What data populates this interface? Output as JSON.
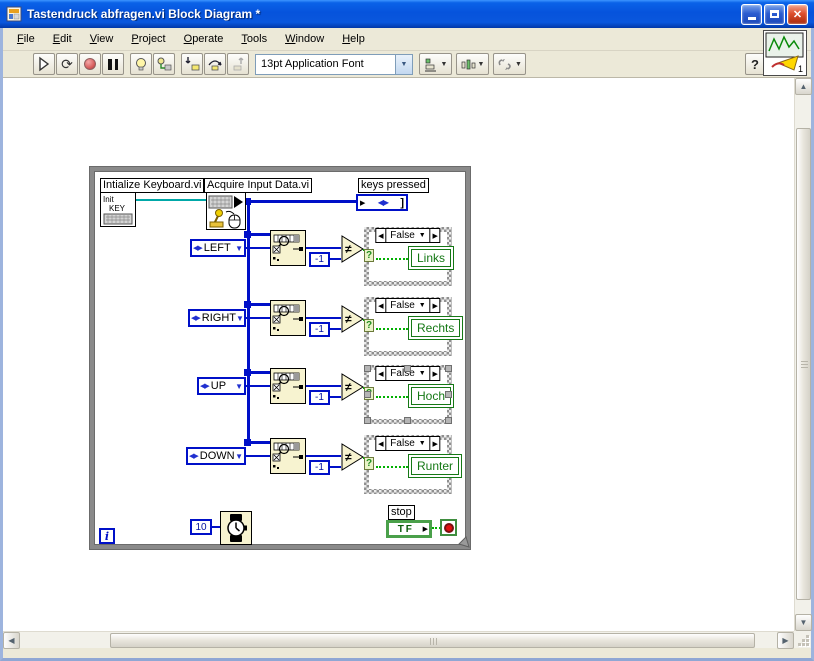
{
  "window": {
    "title": "Tastendruck abfragen.vi Block Diagram *",
    "menus": [
      "File",
      "Edit",
      "View",
      "Project",
      "Operate",
      "Tools",
      "Window",
      "Help"
    ],
    "toolbar": {
      "font_selector": "13pt Application Font",
      "help_label": "?",
      "pane_number": "1"
    }
  },
  "icons": {
    "incdec": "◀▶",
    "dropdown": "▼",
    "case_prev": "◀",
    "case_next": "▶",
    "scroll_up": "▲",
    "scroll_down": "▼",
    "scroll_left": "◀",
    "scroll_right": "▶",
    "array_frame": "▶",
    "array_glyph": "◀▶",
    "array_bracket": "]",
    "tf_arrow": "▶",
    "close": "✕"
  },
  "colors": {
    "wire_blue": "#0010C8",
    "bool_green": "#00B000",
    "indicator_green": "#157815",
    "node_beige": "#F7F3D0",
    "titlebar_blue": "#0653DC",
    "loop_gray": "#8A8A8A"
  },
  "diagram": {
    "loop_iteration": "i",
    "init_vi": {
      "label": "Intialize Keyboard.vi",
      "icon_line1": "Init",
      "icon_line2": "KEY"
    },
    "acquire_vi": {
      "label": "Acquire Input Data.vi"
    },
    "keys_pressed": {
      "label": "keys pressed"
    },
    "wait": {
      "value": "10"
    },
    "stop": {
      "label": "stop",
      "terminal": "TF"
    },
    "rows": [
      {
        "enum": "LEFT",
        "constant": "-1",
        "operator": "≠",
        "selector": "False",
        "selector_question": "?",
        "indicator": "Links",
        "selected": false
      },
      {
        "enum": "RIGHT",
        "constant": "-1",
        "operator": "≠",
        "selector": "False",
        "selector_question": "?",
        "indicator": "Rechts",
        "selected": false
      },
      {
        "enum": "UP",
        "constant": "-1",
        "operator": "≠",
        "selector": "False",
        "selector_question": "?",
        "indicator": "Hoch",
        "selected": true
      },
      {
        "enum": "DOWN",
        "constant": "-1",
        "operator": "≠",
        "selector": "False",
        "selector_question": "?",
        "indicator": "Runter",
        "selected": false
      }
    ]
  }
}
